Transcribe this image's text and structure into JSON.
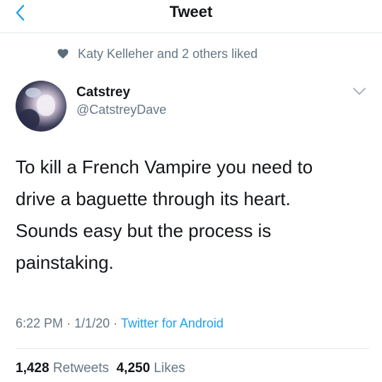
{
  "header": {
    "title": "Tweet",
    "back_icon": "chevron-left-icon",
    "accent_color": "#1da1f2"
  },
  "social_context": {
    "icon": "heart-icon",
    "text": "Katy Kelleher and 2 others liked"
  },
  "author": {
    "display_name": "Catstrey",
    "handle": "@CatstreyDave",
    "menu_icon": "chevron-down-icon"
  },
  "tweet": {
    "text": "To kill a French Vampire you need to\ndrive a baguette through its heart.\nSounds easy but the process is\npainstaking.",
    "time": "6:22 PM",
    "date": "1/1/20",
    "source": "Twitter for Android",
    "separator": "·"
  },
  "stats": {
    "retweets_count": "1,428",
    "retweets_label": "Retweets",
    "likes_count": "4,250",
    "likes_label": "Likes"
  },
  "colors": {
    "text_primary": "#14171a",
    "text_secondary": "#657786",
    "link": "#1da1f2",
    "divider": "#e1e8ed"
  }
}
